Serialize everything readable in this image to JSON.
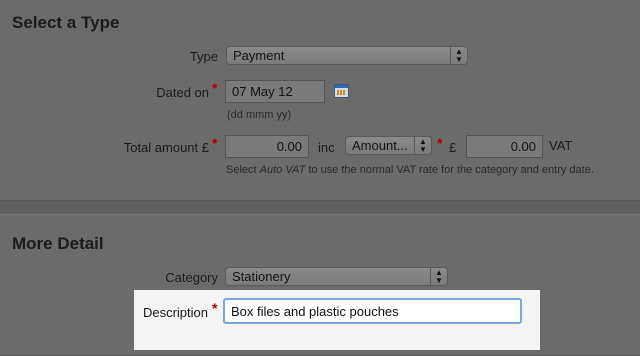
{
  "sections": {
    "type_title": "Select a Type",
    "detail_title": "More Detail"
  },
  "type": {
    "label": "Type",
    "value": "Payment"
  },
  "dated": {
    "label": "Dated on",
    "value": "07 May 12",
    "hint": "(dd mmm yy)"
  },
  "amount": {
    "label": "Total amount £",
    "value": "0.00",
    "inc_label": "inc",
    "mode": "Amount...",
    "vat_currency": "£",
    "vat_value": "0.00",
    "vat_label": "VAT",
    "hint_pre": "Select ",
    "hint_em": "Auto VAT",
    "hint_post": " to use the normal VAT rate for the category and entry date."
  },
  "category": {
    "label": "Category",
    "value": "Stationery"
  },
  "description": {
    "label": "Description",
    "value": "Box files and plastic pouches"
  },
  "required_mark": "*"
}
